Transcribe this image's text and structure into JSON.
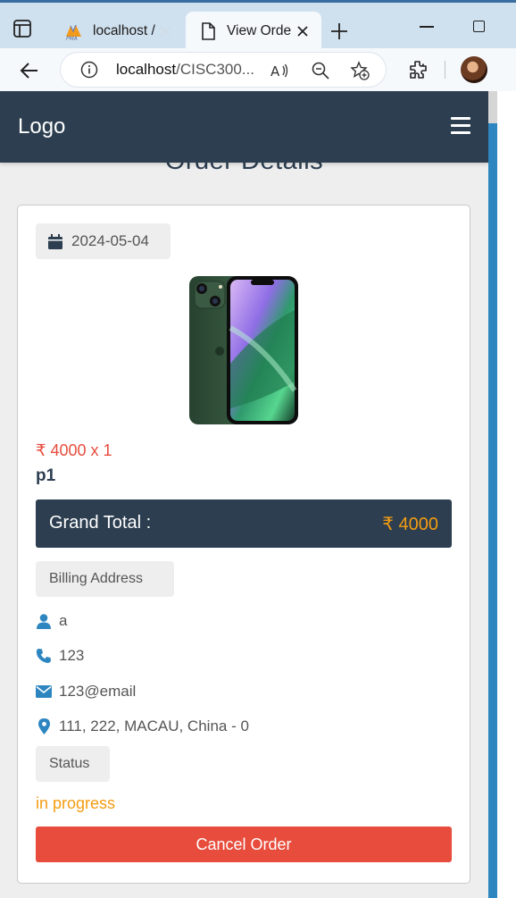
{
  "browser": {
    "tabs": [
      {
        "title": "localhost /",
        "active": false,
        "icon": "phpmyadmin-icon"
      },
      {
        "title": "View Orde",
        "active": true,
        "icon": "page-icon"
      }
    ],
    "url_host": "localhost",
    "url_path": "/CISC300...",
    "colors": {
      "tabbar": "#cfe0ee",
      "toolbar": "#f6f9fc"
    }
  },
  "navbar": {
    "logo": "Logo",
    "menu_icon": "hamburger-icon",
    "background": "#2c3e50"
  },
  "page": {
    "heading": "Order Details"
  },
  "order": {
    "date": "2024-05-04",
    "price_line": "₹ 4000 x 1",
    "product_name": "p1",
    "grand_total_label": "Grand Total :",
    "grand_total_value": "₹ 4000",
    "billing_label": "Billing Address",
    "billing": {
      "name": "a",
      "phone": "123",
      "email": "123@email",
      "address": "111, 222, MACAU, China - 0"
    },
    "status_label": "Status",
    "status_value": "in progress",
    "cancel_label": "Cancel Order"
  },
  "colors": {
    "accent_red": "#e74c3c",
    "status_orange": "#f39c12",
    "icon_blue": "#2e86c1",
    "dark_navy": "#2c3e50"
  }
}
